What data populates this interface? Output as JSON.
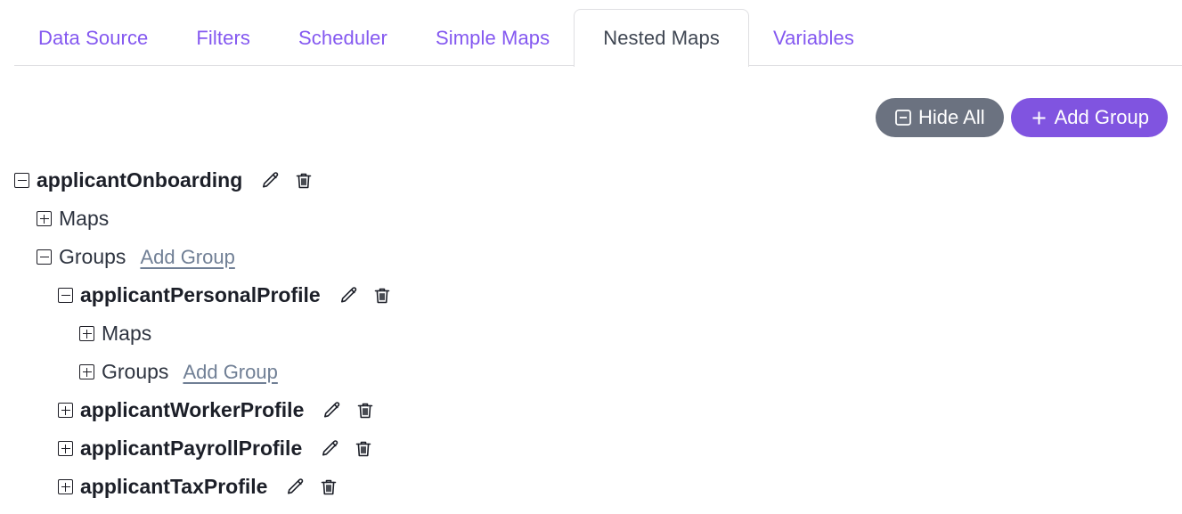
{
  "tabs": [
    {
      "label": "Data Source",
      "active": false
    },
    {
      "label": "Filters",
      "active": false
    },
    {
      "label": "Scheduler",
      "active": false
    },
    {
      "label": "Simple Maps",
      "active": false
    },
    {
      "label": "Nested Maps",
      "active": true
    },
    {
      "label": "Variables",
      "active": false
    }
  ],
  "toolbar": {
    "hide_all_label": "Hide All",
    "hide_all_icon": "minus-square-icon",
    "add_group_label": "Add Group",
    "add_group_icon": "plus-icon"
  },
  "colors": {
    "tab_inactive": "#8458f0",
    "tab_active_text": "#3f4652",
    "hide_all_bg": "#6b7280",
    "add_group_bg": "#8054e0",
    "link": "#707f95",
    "text": "#2d3340",
    "border": "#dfdfe2"
  },
  "tree": {
    "root": {
      "name": "applicantOnboarding",
      "expanded": true,
      "toggle_icon": "minus-square-icon",
      "edit_icon": "pencil-icon",
      "delete_icon": "trash-icon",
      "maps_label": "Maps",
      "maps_expanded": false,
      "groups_label": "Groups",
      "groups_expanded": true,
      "add_group_link": "Add Group"
    },
    "children": [
      {
        "name": "applicantPersonalProfile",
        "expanded": true,
        "toggle_icon": "minus-square-icon",
        "edit_icon": "pencil-icon",
        "delete_icon": "trash-icon",
        "maps_label": "Maps",
        "maps_expanded": false,
        "groups_label": "Groups",
        "groups_expanded": false,
        "add_group_link": "Add Group"
      },
      {
        "name": "applicantWorkerProfile",
        "expanded": false,
        "toggle_icon": "plus-square-icon",
        "edit_icon": "pencil-icon",
        "delete_icon": "trash-icon"
      },
      {
        "name": "applicantPayrollProfile",
        "expanded": false,
        "toggle_icon": "plus-square-icon",
        "edit_icon": "pencil-icon",
        "delete_icon": "trash-icon"
      },
      {
        "name": "applicantTaxProfile",
        "expanded": false,
        "toggle_icon": "plus-square-icon",
        "edit_icon": "pencil-icon",
        "delete_icon": "trash-icon"
      }
    ]
  }
}
